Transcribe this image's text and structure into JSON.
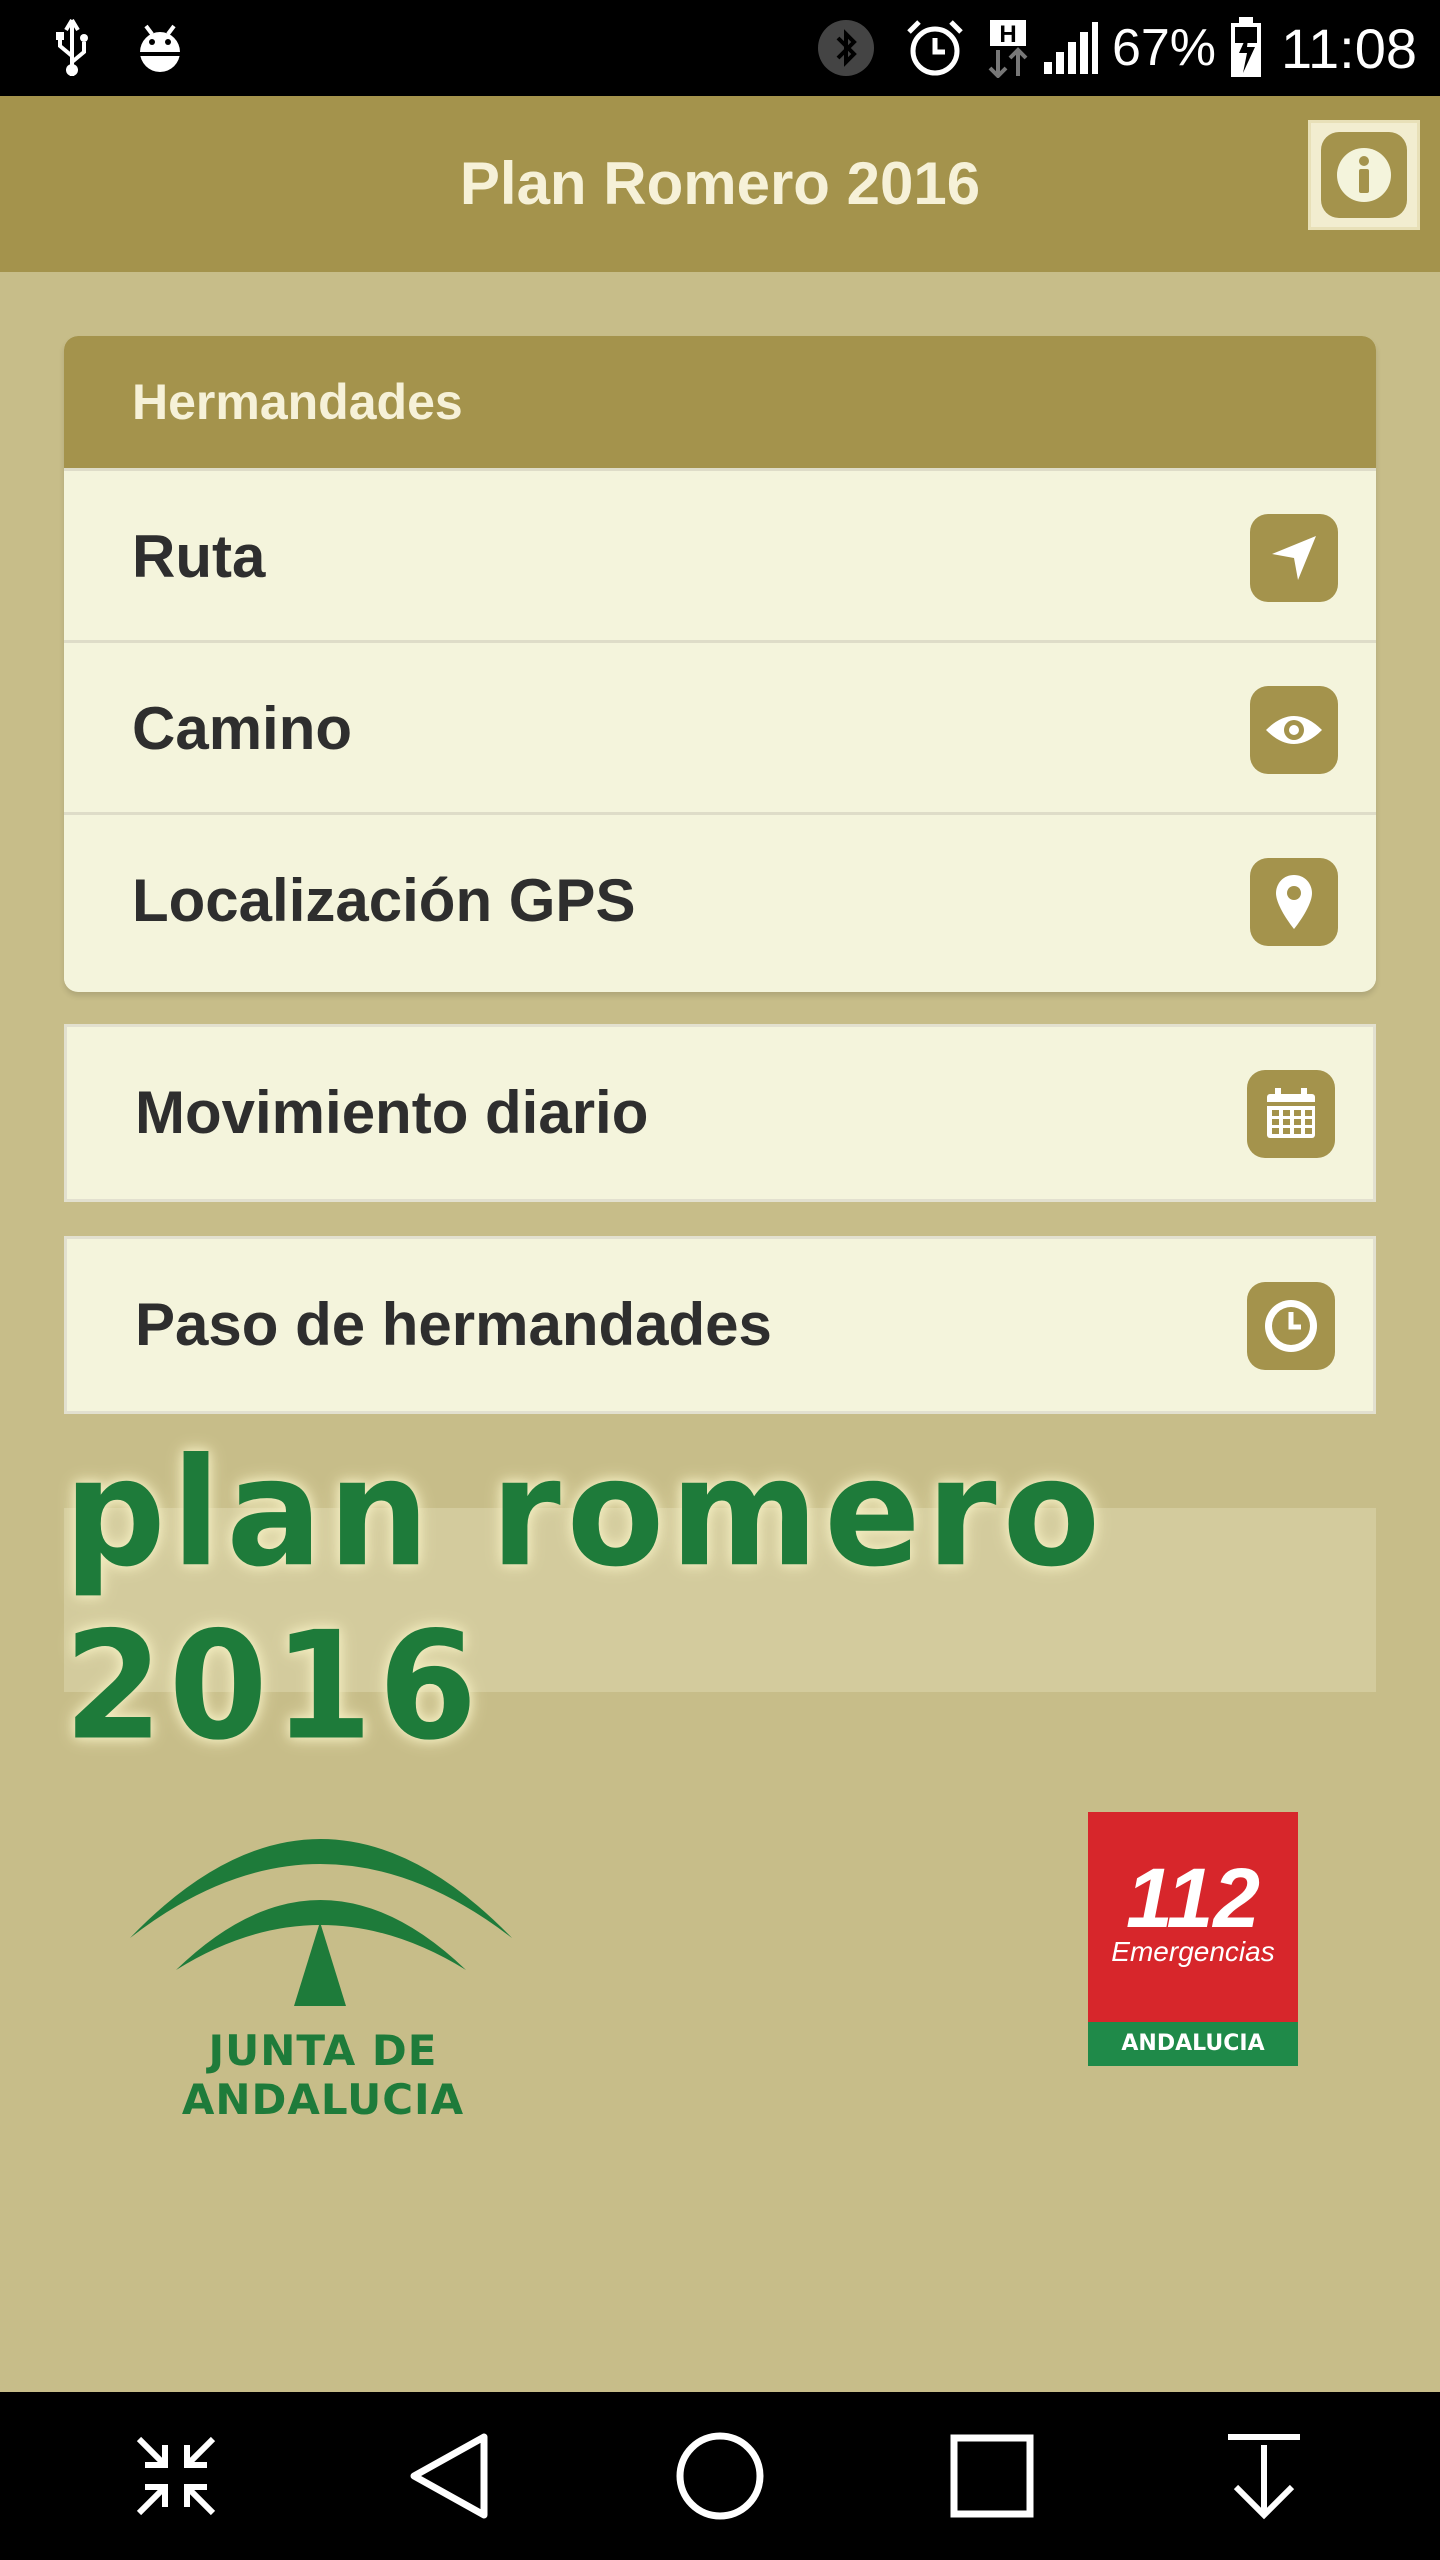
{
  "status_bar": {
    "battery_percent": "67%",
    "time": "11:08",
    "network_type": "H",
    "icons": [
      "usb-icon",
      "android-debug-icon",
      "bluetooth-icon",
      "alarm-icon",
      "network-h-icon",
      "signal-icon",
      "battery-charging-icon"
    ]
  },
  "app_bar": {
    "title": "Plan Romero 2016",
    "info_icon": "info-icon"
  },
  "hermandades_group": {
    "header": "Hermandades",
    "items": [
      {
        "label": "Ruta",
        "icon": "navigation-arrow-icon"
      },
      {
        "label": "Camino",
        "icon": "eye-icon"
      },
      {
        "label": "Localización GPS",
        "icon": "map-pin-icon"
      }
    ]
  },
  "standalone_items": [
    {
      "label": "Movimiento diario",
      "icon": "calendar-icon"
    },
    {
      "label": "Paso de hermandades",
      "icon": "clock-icon"
    }
  ],
  "banner": {
    "text": "plan romero 2016"
  },
  "logos": {
    "junta": "JUNTA DE ANDALUCIA",
    "emergencias_number": "112",
    "emergencias_label": "Emergencias",
    "emergencias_region": "ANDALUCIA"
  },
  "nav_bar": {
    "buttons": [
      "collapse-icon",
      "back-icon",
      "home-icon",
      "recents-icon",
      "download-icon"
    ]
  },
  "colors": {
    "accent": "#a4934c",
    "background": "#c7bd89",
    "card": "#f4f4dc",
    "green": "#1e7b3a",
    "red": "#d7262b"
  }
}
